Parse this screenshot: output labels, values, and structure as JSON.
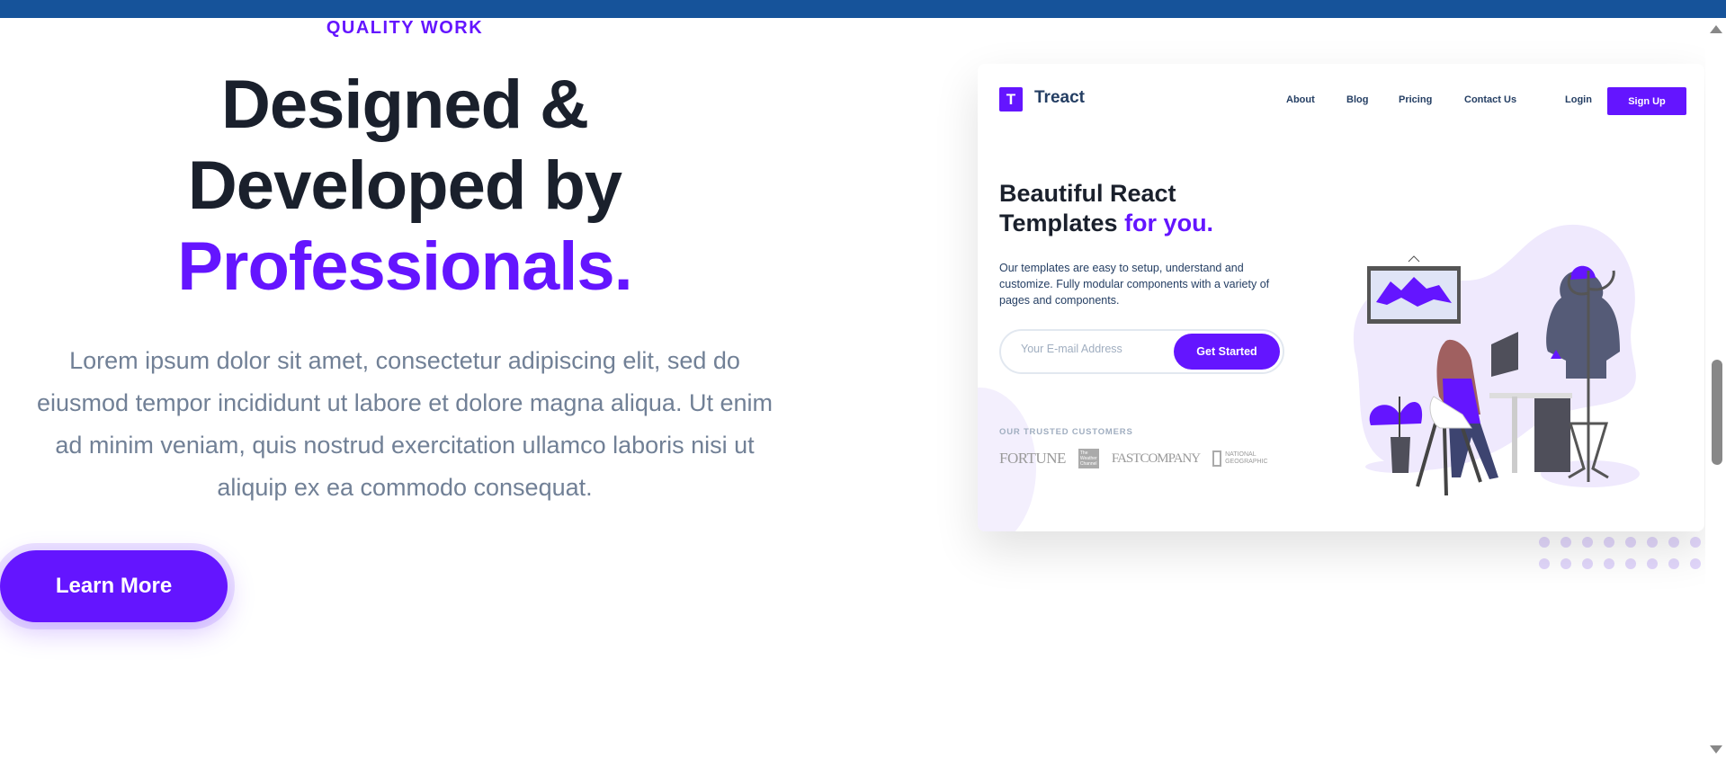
{
  "hero": {
    "subheading": "QUALITY WORK",
    "heading_line1": "Designed &",
    "heading_line2": "Developed by",
    "heading_accent": "Professionals.",
    "description": "Lorem ipsum dolor sit amet, consectetur adipiscing elit, sed do eiusmod tempor incididunt ut labore et dolore magna aliqua. Ut enim ad minim veniam, quis nostrud exercitation ullamco laboris nisi ut aliquip ex ea commodo consequat.",
    "cta_label": "Learn More"
  },
  "preview": {
    "logo_letter": "T",
    "brand": "Treact",
    "nav": [
      "About",
      "Blog",
      "Pricing",
      "Contact Us"
    ],
    "login": "Login",
    "signup": "Sign Up",
    "title_line1": "Beautiful React",
    "title_line2": "Templates",
    "title_accent": "for you.",
    "description": "Our templates are easy to setup, understand and customize. Fully modular components with a variety of pages and components.",
    "email_placeholder": "Your E-mail Address",
    "get_started": "Get Started",
    "trusted_label": "OUR TRUSTED CUSTOMERS",
    "customers": [
      "FORTUNE",
      "The Weather Channel",
      "FASTCOMPANY",
      "NATIONAL GEOGRAPHIC"
    ]
  },
  "colors": {
    "accent": "#6415ff",
    "topbar": "#16539a",
    "heading": "#1a202c",
    "text": "#718096"
  }
}
